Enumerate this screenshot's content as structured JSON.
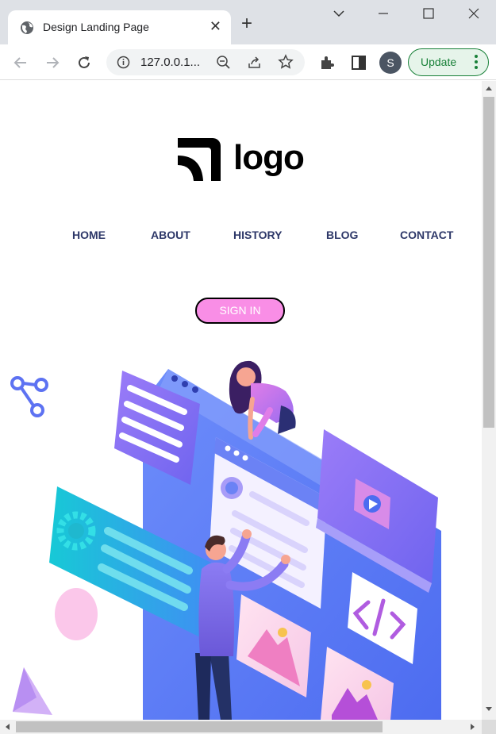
{
  "browser": {
    "tab_title": "Design Landing Page",
    "tab_close": "✕",
    "new_tab": "+",
    "url": "127.0.0.1...",
    "avatar_letter": "S",
    "update_label": "Update"
  },
  "page": {
    "logo_text": "logo",
    "nav": [
      "HOME",
      "ABOUT",
      "HISTORY",
      "BLOG",
      "CONTACT"
    ],
    "signin_label": "SIGN IN"
  },
  "colors": {
    "nav_text": "#2d3768",
    "signin_bg": "#f98ee6",
    "accent_blue": "#5b7cf5",
    "accent_purple": "#9a6cf0",
    "update_green": "#188038"
  }
}
